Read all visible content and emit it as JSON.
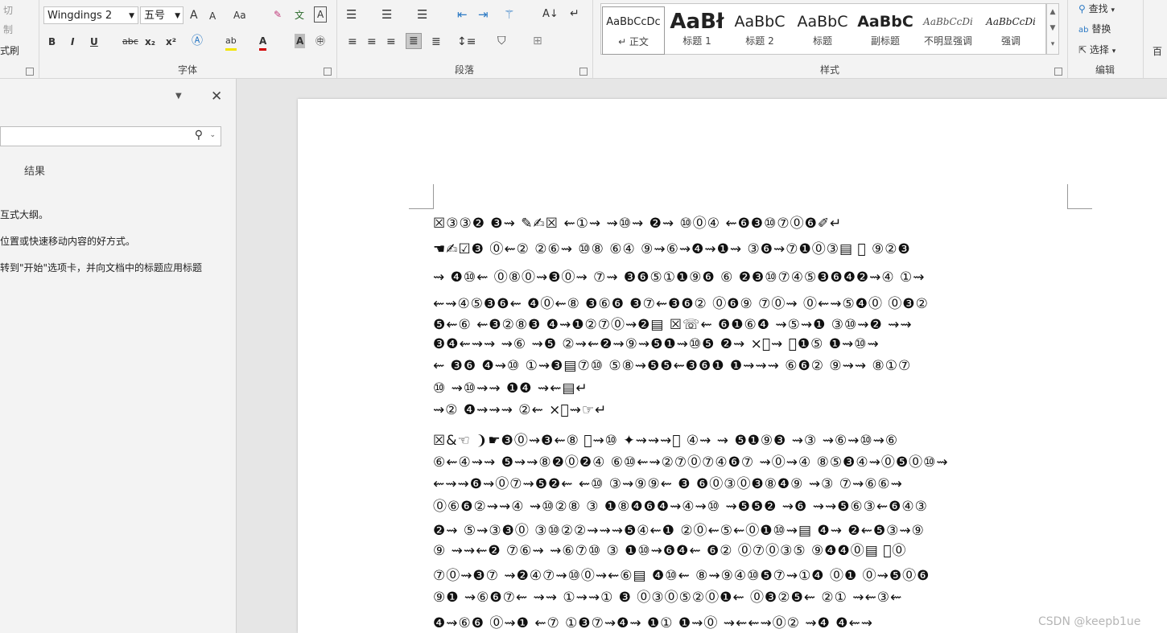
{
  "ribbon": {
    "clipboard": {
      "partial_labels": [
        "切",
        "制",
        "式刷"
      ]
    },
    "font": {
      "font_name": "Wingdings 2",
      "font_size": "五号",
      "group_label": "字体",
      "buttons": {
        "grow": "A",
        "shrink": "A",
        "case": "Aa",
        "bold": "B",
        "italic": "I",
        "underline": "U",
        "strike": "abc",
        "subscript": "x₂",
        "superscript": "x²",
        "highlight": "ab",
        "font_color": "A",
        "char_shade": "A",
        "enclose": "㊥",
        "phonetic": "文",
        "border": "A"
      }
    },
    "paragraph": {
      "group_label": "段落"
    },
    "styles": {
      "group_label": "样式",
      "items": [
        {
          "preview": "AaBbCcDc",
          "name": "↵ 正文"
        },
        {
          "preview": "AaBł",
          "name": "标题 1"
        },
        {
          "preview": "AaBbC",
          "name": "标题 2"
        },
        {
          "preview": "AaBbC",
          "name": "标题"
        },
        {
          "preview": "AaBbC",
          "name": "副标题"
        },
        {
          "preview": "AaBbCcDi",
          "name": "不明显强调"
        },
        {
          "preview": "AaBbCcDi",
          "name": "强调"
        }
      ]
    },
    "editing": {
      "find": "查找",
      "replace": "替换",
      "select": "选择",
      "group_label": "编辑",
      "partial": "百"
    }
  },
  "navpane": {
    "search_placeholder": "",
    "tab_results": "结果",
    "hints": [
      "互式大纲。",
      "位置或快速移动内容的好方式。",
      "转到\"开始\"选项卡，并向文档中的标题应用标题"
    ]
  },
  "document": {
    "lines": [
      "☒③③❷ ❸⇝ ✎✍☒ ⇜①⇝ ⇝⑩⇝ ❷⇝ ⑩⓪④ ⇜❻❸⑩⑦⓪❻✐↵",
      "☚✍☑❸ ⓪⇜② ②⑥⇝ ⑩⑧ ⑥④ ⑨⇝⑥⇝❹⇝❶⇝ ③❻⇝⑦❶⓪③▤ ⃠ ⑨②❸",
      "⇝ ❹⑩⇜ ⓪⑧⓪⇝❸⓪⇝ ⑦⇝ ❸❻⑤①❶⑨❻ ⑥ ❷❸⑩⑦④⑤❸❻❹❷⇝④ ①⇝",
      "⇜⇝④⑤❸❻⇜ ❹⓪⇜⑧ ❸⑥❻ ❸⑦⇜❸❻② ⓪❻⑨ ⑦⓪⇝ ⓪⇜⇝⑤❹⓪ ⓪❸②",
      "❺⇜⑥ ⇜❸②⑧❸ ❹⇝❶②⑦⓪⇝❷▤ ☒☏⇜ ❻❶⑥❹ ⇝⑤⇝❶ ③⑩⇝❷ ⇝⇝",
      "❸❹⇜⇝⇝ ⇝⑥ ⇝❺ ②⇝⇜❷⇝⑨⇝❺❶⇝⑩❺ ❷⇝ ×⃠⇝ ⓪❶⑤ ❶⇝⑩⇝",
      "⇜ ❸❻ ❹⇝⑩ ①⇝❸▤⑦⑩ ⑤⑧⇝❺❺⇜❸❻❶ ❶⇝⇝⇝ ⑥❻② ⑨⇝⇝ ⑧①⑦",
      "⑩ ⇝⑩⇝⇝ ❶❹ ⇝⇜▤↵",
      "⇝② ❹⇝⇝⇝ ②⇜ ×⃠⇝☞↵",
      "☒&☜ ❩☛❸⓪⇝❸⇜⑧ ⃠⇝⑩ ✦⇝⇝⇝⎘ ④⇝ ⇝ ❺❶⑨❸ ⇝③ ⇝⑥⇝⑩⇝⑥",
      "⑥⇜④⇝⇝ ❺⇝⇝⑧❷⓪❷④ ⑥⑩⇜⇝②⑦⓪⑦④❻⑦ ⇝⓪⇝④ ⑧⑤❸④⇝⓪❺⓪⑩⇝",
      "⇜⇝⇝❻⇝⓪⑦⇝❺❷⇜ ⇜⑩ ③⇝⑨⑨⇜ ❸ ❻⓪③⓪❸⑧❹⑨ ⇝③ ⑦⇝⑥⑥⇝",
      "⓪⑥❻②⇝⇝④ ⇝⑩②⑧ ③ ❶⑧❹❻❹⇝④⇝⑩ ⇝❺❺❷ ⇝❻ ⇝⇝❺⑥③⇜❻④③",
      "❷⇝ ⑤⇝③❸⓪ ③⑩②②⇝⇝⇝❺④⇜❶ ②⓪⇜⑤⇜⓪❶⑩⇝▤ ❹⇝ ❷⇜❺③⇝⑨",
      "⑨ ⇝⇝⇜❷ ⑦⑥⇝ ⇝⑥⑦⑩ ③ ❶⑩⇝❻❹⇜ ❻② ⓪⑦⓪③⑤ ⑨❹❹⓪▤ ⃠⓪",
      "⑦⓪⇝❸⑦ ⇝❷④⑦⇝⑩⓪⇝⇜⑥▤ ❹⑩⇜ ⑧⇝⑨④⑩❺⑦⇝①❹ ⓪❶ ⓪⇝❺⓪❻",
      "⑨❶ ⇝⑥❻⑦⇜ ⇝⇝ ①⇝⇝① ❸ ⓪③⓪⑤②⓪❶⇜ ⓪❸②❺⇜ ②① ⇝⇜③⇜",
      "❹⇝⑥❻ ⓪⇝❶ ⇜⑦ ①❸⑦⇝❹⇝ ❶① ❶⇝⓪ ⇝⇜⇜⇝⓪② ⇝❹ ❹⇜⇝"
    ]
  },
  "watermark": "CSDN @keepb1ue"
}
